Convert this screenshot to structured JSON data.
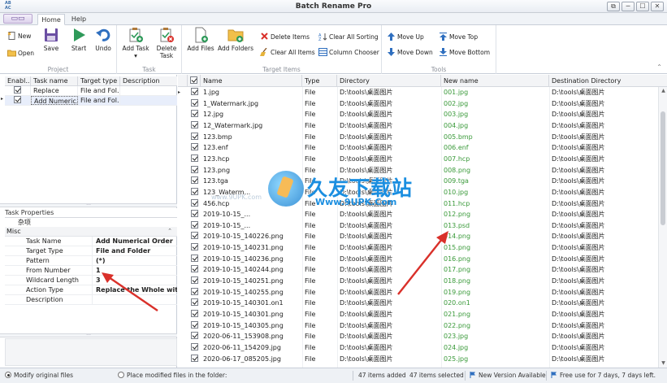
{
  "window": {
    "title": "Batch Rename Pro",
    "icon_text_top": "AB",
    "icon_text_bottom": "AC"
  },
  "window_buttons": [
    "⧉",
    "─",
    "☐",
    "✕"
  ],
  "ribbon_tabs": [
    {
      "label": "Home",
      "active": true
    },
    {
      "label": "Help",
      "active": false
    }
  ],
  "ribbon": {
    "groups": [
      {
        "label": "Project",
        "buttons": [
          {
            "label": "New",
            "icon": "new-file-icon"
          },
          {
            "label": "Open",
            "icon": "open-folder-icon"
          },
          {
            "label": "Save",
            "icon": "save-disk-icon"
          }
        ]
      },
      {
        "label": "",
        "buttons": [
          {
            "label": "Start",
            "icon": "play-icon"
          },
          {
            "label": "Undo",
            "icon": "undo-icon"
          }
        ]
      },
      {
        "label": "Task",
        "buttons": [
          {
            "label": "Add Task",
            "icon": "add-task-icon"
          },
          {
            "label": "Delete Task",
            "icon": "delete-task-icon"
          }
        ]
      },
      {
        "label": "Target Items",
        "buttons": [
          {
            "label": "Add Files",
            "icon": "add-file-icon"
          },
          {
            "label": "Add Folders",
            "icon": "add-folder-icon"
          },
          {
            "label": "Delete Items",
            "icon": "delete-x-icon"
          },
          {
            "label": "Clear All Items",
            "icon": "broom-icon"
          },
          {
            "label": "Clear All Sorting",
            "icon": "sort-icon"
          },
          {
            "label": "Column Chooser",
            "icon": "columns-icon"
          }
        ]
      },
      {
        "label": "Tools",
        "buttons": [
          {
            "label": "Move Up",
            "icon": "arrow-up-icon"
          },
          {
            "label": "Move Down",
            "icon": "arrow-down-icon"
          },
          {
            "label": "Move Top",
            "icon": "arrow-top-icon"
          },
          {
            "label": "Move Bottom",
            "icon": "arrow-bottom-icon"
          }
        ]
      }
    ],
    "collapse_glyph": "⌃"
  },
  "task_grid": {
    "headers": [
      "Enabl...",
      "Task name",
      "Target type",
      "Description"
    ],
    "rows": [
      {
        "enabled": true,
        "name": "Replace",
        "target": "File and Fol...",
        "desc": "",
        "selected": false
      },
      {
        "enabled": true,
        "name": "Add Numeric...",
        "target": "File and Fol...",
        "desc": "",
        "selected": true
      }
    ]
  },
  "task_properties": {
    "title": "Task Properties",
    "category_label": "杂项",
    "section": "Misc",
    "rows": [
      {
        "key": "Task Name",
        "value": "Add Numerical Order"
      },
      {
        "key": "Target Type",
        "value": "File and Folder"
      },
      {
        "key": "Pattern",
        "value": "(*)"
      },
      {
        "key": "From Number",
        "value": "1"
      },
      {
        "key": "Wildcard Length",
        "value": "3"
      },
      {
        "key": "Action Type",
        "value": "Replace the Whole wit..."
      },
      {
        "key": "Description",
        "value": ""
      }
    ]
  },
  "file_grid": {
    "headers": [
      "Name",
      "Type",
      "Directory",
      "New name",
      "Destination Directory"
    ],
    "rows": [
      {
        "name": "1.jpg",
        "type": "File",
        "dir": "D:\\tools\\桌面图片",
        "new": "001.jpg",
        "dest": "D:\\tools\\桌面图片"
      },
      {
        "name": "1_Watermark.jpg",
        "type": "File",
        "dir": "D:\\tools\\桌面图片",
        "new": "002.jpg",
        "dest": "D:\\tools\\桌面图片"
      },
      {
        "name": "12.jpg",
        "type": "File",
        "dir": "D:\\tools\\桌面图片",
        "new": "003.jpg",
        "dest": "D:\\tools\\桌面图片"
      },
      {
        "name": "12_Watermark.jpg",
        "type": "File",
        "dir": "D:\\tools\\桌面图片",
        "new": "004.jpg",
        "dest": "D:\\tools\\桌面图片"
      },
      {
        "name": "123.bmp",
        "type": "File",
        "dir": "D:\\tools\\桌面图片",
        "new": "005.bmp",
        "dest": "D:\\tools\\桌面图片"
      },
      {
        "name": "123.enf",
        "type": "File",
        "dir": "D:\\tools\\桌面图片",
        "new": "006.enf",
        "dest": "D:\\tools\\桌面图片"
      },
      {
        "name": "123.hcp",
        "type": "File",
        "dir": "D:\\tools\\桌面图片",
        "new": "007.hcp",
        "dest": "D:\\tools\\桌面图片"
      },
      {
        "name": "123.png",
        "type": "File",
        "dir": "D:\\tools\\桌面图片",
        "new": "008.png",
        "dest": "D:\\tools\\桌面图片"
      },
      {
        "name": "123.tga",
        "type": "File",
        "dir": "D:\\tools\\桌面图片",
        "new": "009.tga",
        "dest": "D:\\tools\\桌面图片"
      },
      {
        "name": "123_Waterm...",
        "type": "File",
        "dir": "D:\\tools\\桌面图片",
        "new": "010.jpg",
        "dest": "D:\\tools\\桌面图片"
      },
      {
        "name": "456.hcp",
        "type": "File",
        "dir": "D:\\tools\\桌面图片",
        "new": "011.hcp",
        "dest": "D:\\tools\\桌面图片"
      },
      {
        "name": "2019-10-15_...",
        "type": "File",
        "dir": "D:\\tools\\桌面图片",
        "new": "012.png",
        "dest": "D:\\tools\\桌面图片"
      },
      {
        "name": "2019-10-15_...",
        "type": "File",
        "dir": "D:\\tools\\桌面图片",
        "new": "013.psd",
        "dest": "D:\\tools\\桌面图片"
      },
      {
        "name": "2019-10-15_140226.png",
        "type": "File",
        "dir": "D:\\tools\\桌面图片",
        "new": "014.png",
        "dest": "D:\\tools\\桌面图片"
      },
      {
        "name": "2019-10-15_140231.png",
        "type": "File",
        "dir": "D:\\tools\\桌面图片",
        "new": "015.png",
        "dest": "D:\\tools\\桌面图片"
      },
      {
        "name": "2019-10-15_140236.png",
        "type": "File",
        "dir": "D:\\tools\\桌面图片",
        "new": "016.png",
        "dest": "D:\\tools\\桌面图片"
      },
      {
        "name": "2019-10-15_140244.png",
        "type": "File",
        "dir": "D:\\tools\\桌面图片",
        "new": "017.png",
        "dest": "D:\\tools\\桌面图片"
      },
      {
        "name": "2019-10-15_140251.png",
        "type": "File",
        "dir": "D:\\tools\\桌面图片",
        "new": "018.png",
        "dest": "D:\\tools\\桌面图片"
      },
      {
        "name": "2019-10-15_140255.png",
        "type": "File",
        "dir": "D:\\tools\\桌面图片",
        "new": "019.png",
        "dest": "D:\\tools\\桌面图片"
      },
      {
        "name": "2019-10-15_140301.on1",
        "type": "File",
        "dir": "D:\\tools\\桌面图片",
        "new": "020.on1",
        "dest": "D:\\tools\\桌面图片"
      },
      {
        "name": "2019-10-15_140301.png",
        "type": "File",
        "dir": "D:\\tools\\桌面图片",
        "new": "021.png",
        "dest": "D:\\tools\\桌面图片"
      },
      {
        "name": "2019-10-15_140305.png",
        "type": "File",
        "dir": "D:\\tools\\桌面图片",
        "new": "022.png",
        "dest": "D:\\tools\\桌面图片"
      },
      {
        "name": "2020-06-11_153908.png",
        "type": "File",
        "dir": "D:\\tools\\桌面图片",
        "new": "023.jpg",
        "dest": "D:\\tools\\桌面图片"
      },
      {
        "name": "2020-06-11_154209.jpg",
        "type": "File",
        "dir": "D:\\tools\\桌面图片",
        "new": "024.jpg",
        "dest": "D:\\tools\\桌面图片"
      },
      {
        "name": "2020-06-17_085205.jpg",
        "type": "File",
        "dir": "D:\\tools\\桌面图片",
        "new": "025.jpg",
        "dest": "D:\\tools\\桌面图片"
      }
    ]
  },
  "watermark": {
    "text_cn": "久友下载站",
    "url": "Www.9UPK.Com",
    "url_small": "www.9UPK.com"
  },
  "status_bar": {
    "modify_original": "Modify original files",
    "place_modified": "Place modified files in the folder:",
    "items_added": "47 items added",
    "items_selected": "47 items selected",
    "new_version": "New Version Available",
    "free_use": "Free use for 7 days, 7 days left."
  },
  "colors": {
    "new_name_green": "#3a9a3a",
    "annotation_red": "#d9302a",
    "ribbon_blue": "#2f6fbf"
  }
}
